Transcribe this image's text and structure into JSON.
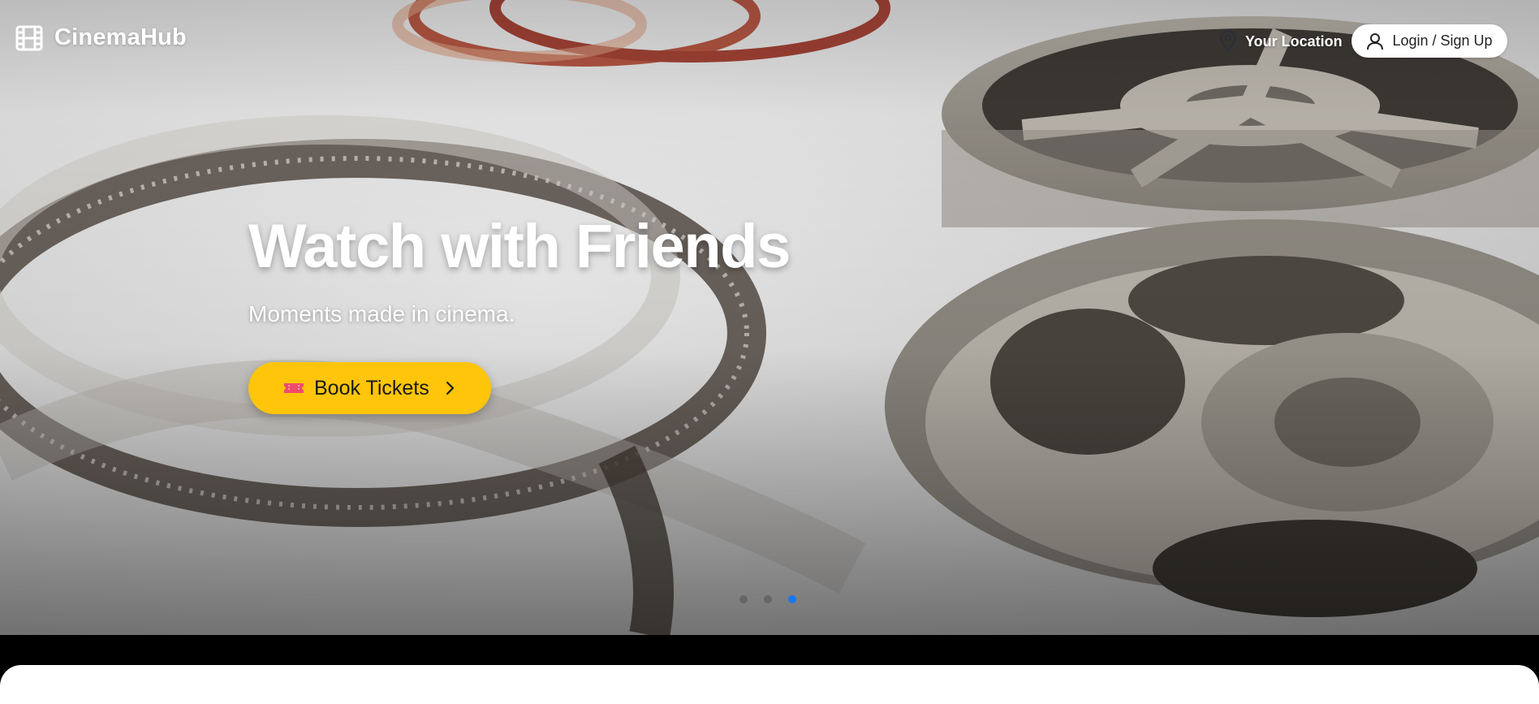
{
  "brand": {
    "name": "CinemaHub",
    "icon": "film-icon"
  },
  "nav": {
    "location_label": "Your Location",
    "location_icon": "map-pin-icon",
    "login_label": "Login / Sign Up",
    "login_icon": "user-icon"
  },
  "hero": {
    "headline": "Watch with Friends",
    "subtitle": "Moments made in cinema.",
    "cta": {
      "label": "Book Tickets",
      "icon": "ticket-icon",
      "trailing_icon": "chevron-right-icon"
    },
    "carousel": {
      "slide_count": 3,
      "active_index": 2
    }
  },
  "colors": {
    "cta_background": "#fec50b",
    "active_dot": "#1877f2",
    "page_background": "#000000"
  }
}
